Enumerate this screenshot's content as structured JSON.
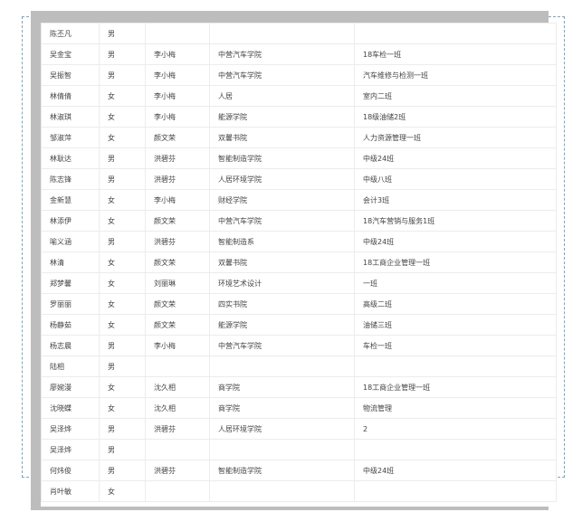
{
  "rows": [
    {
      "name": "陈丕凡",
      "gender": "男",
      "teacher": "",
      "college": "",
      "class": ""
    },
    {
      "name": "吴金宝",
      "gender": "男",
      "teacher": "李小梅",
      "college": "中营汽车学院",
      "class": "18车检一班"
    },
    {
      "name": "吴振智",
      "gender": "男",
      "teacher": "李小梅",
      "college": "中营汽车学院",
      "class": "汽车维修与检测一班"
    },
    {
      "name": "林倩倩",
      "gender": "女",
      "teacher": "李小梅",
      "college": "人居",
      "class": "室内二班"
    },
    {
      "name": "林淑琪",
      "gender": "女",
      "teacher": "李小梅",
      "college": "能源学院",
      "class": "18级油储2班"
    },
    {
      "name": "邹淑萍",
      "gender": "女",
      "teacher": "颜文荣",
      "college": "双馨书院",
      "class": "人力资源管理一班"
    },
    {
      "name": "林耿达",
      "gender": "男",
      "teacher": "洪碧芬",
      "college": "智能制造学院",
      "class": "中级24班"
    },
    {
      "name": "陈志锋",
      "gender": "男",
      "teacher": "洪碧芬",
      "college": "人居环境学院",
      "class": "中级八班"
    },
    {
      "name": "金新慧",
      "gender": "女",
      "teacher": "李小梅",
      "college": "财经学院",
      "class": "会计3班"
    },
    {
      "name": "林添伊",
      "gender": "女",
      "teacher": "颜文荣",
      "college": "中营汽车学院",
      "class": "18汽车营销与服务1班"
    },
    {
      "name": "喻义涵",
      "gender": "男",
      "teacher": "洪碧芬",
      "college": "智能制造系",
      "class": "中级24班"
    },
    {
      "name": "林清",
      "gender": "女",
      "teacher": "颜文荣",
      "college": "双馨书院",
      "class": "18工商企业管理一班"
    },
    {
      "name": "郑梦馨",
      "gender": "女",
      "teacher": "刘丽琳",
      "college": "环境艺术设计",
      "class": "一班"
    },
    {
      "name": "罗丽丽",
      "gender": "女",
      "teacher": "颜文荣",
      "college": "四实书院",
      "class": "高级二班"
    },
    {
      "name": "杨静茹",
      "gender": "女",
      "teacher": "颜文荣",
      "college": "能源学院",
      "class": "油储三班"
    },
    {
      "name": "杨志晨",
      "gender": "男",
      "teacher": "李小梅",
      "college": "中营汽车学院",
      "class": "车检一班"
    },
    {
      "name": "陆相",
      "gender": "男",
      "teacher": "",
      "college": "",
      "class": ""
    },
    {
      "name": "廖婉漫",
      "gender": "女",
      "teacher": "沈久相",
      "college": "商学院",
      "class": "18工商企业管理一班"
    },
    {
      "name": "沈晓蝶",
      "gender": "女",
      "teacher": "沈久相",
      "college": "商学院",
      "class": "物流管理"
    },
    {
      "name": "吴泽烨",
      "gender": "男",
      "teacher": "洪碧芬",
      "college": "人居环境学院",
      "class": "2"
    },
    {
      "name": "吴泽烨",
      "gender": "男",
      "teacher": "",
      "college": "",
      "class": ""
    },
    {
      "name": "何炜俊",
      "gender": "男",
      "teacher": "洪碧芬",
      "college": "智能制造学院",
      "class": "中级24班"
    },
    {
      "name": "肖叶敏",
      "gender": "女",
      "teacher": "",
      "college": "",
      "class": ""
    }
  ]
}
